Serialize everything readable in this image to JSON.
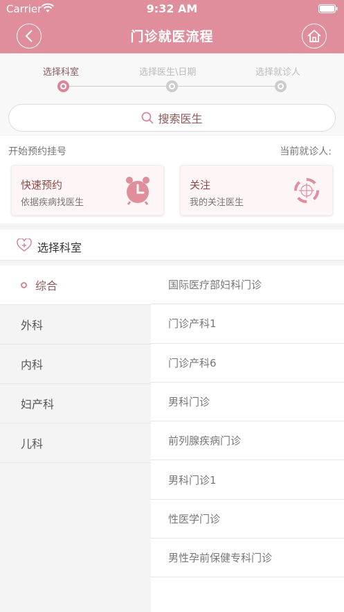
{
  "status_bar": {
    "carrier": "Carrier",
    "time": "9:32 AM"
  },
  "nav": {
    "title": "门诊就医流程"
  },
  "steps": [
    {
      "label": "选择科室",
      "active": true
    },
    {
      "label": "选择医生\\日期",
      "active": false
    },
    {
      "label": "选择就诊人",
      "active": false
    }
  ],
  "search": {
    "label": "搜索医生"
  },
  "quick": {
    "left_label": "开始预约挂号",
    "right_label": "当前就诊人:",
    "cards": [
      {
        "title": "快速预约",
        "subtitle": "依据疾病找医生",
        "icon": "alarm-clock-icon"
      },
      {
        "title": "关注",
        "subtitle": "我的关注医生",
        "icon": "target-icon"
      }
    ]
  },
  "dept": {
    "header": "选择科室",
    "categories": [
      "综合",
      "外科",
      "内科",
      "妇产科",
      "儿科"
    ],
    "selected_category": "综合",
    "departments": [
      "国际医疗部妇科门诊",
      "门诊产科1",
      "门诊产科6",
      "男科门诊",
      "前列腺疾病门诊",
      "男科门诊1",
      "性医学门诊",
      "男性孕前保健专科门诊"
    ]
  },
  "colors": {
    "accent": "#e08e9b",
    "accent_dark": "#d98797",
    "text_brown": "#8a5a5a"
  }
}
